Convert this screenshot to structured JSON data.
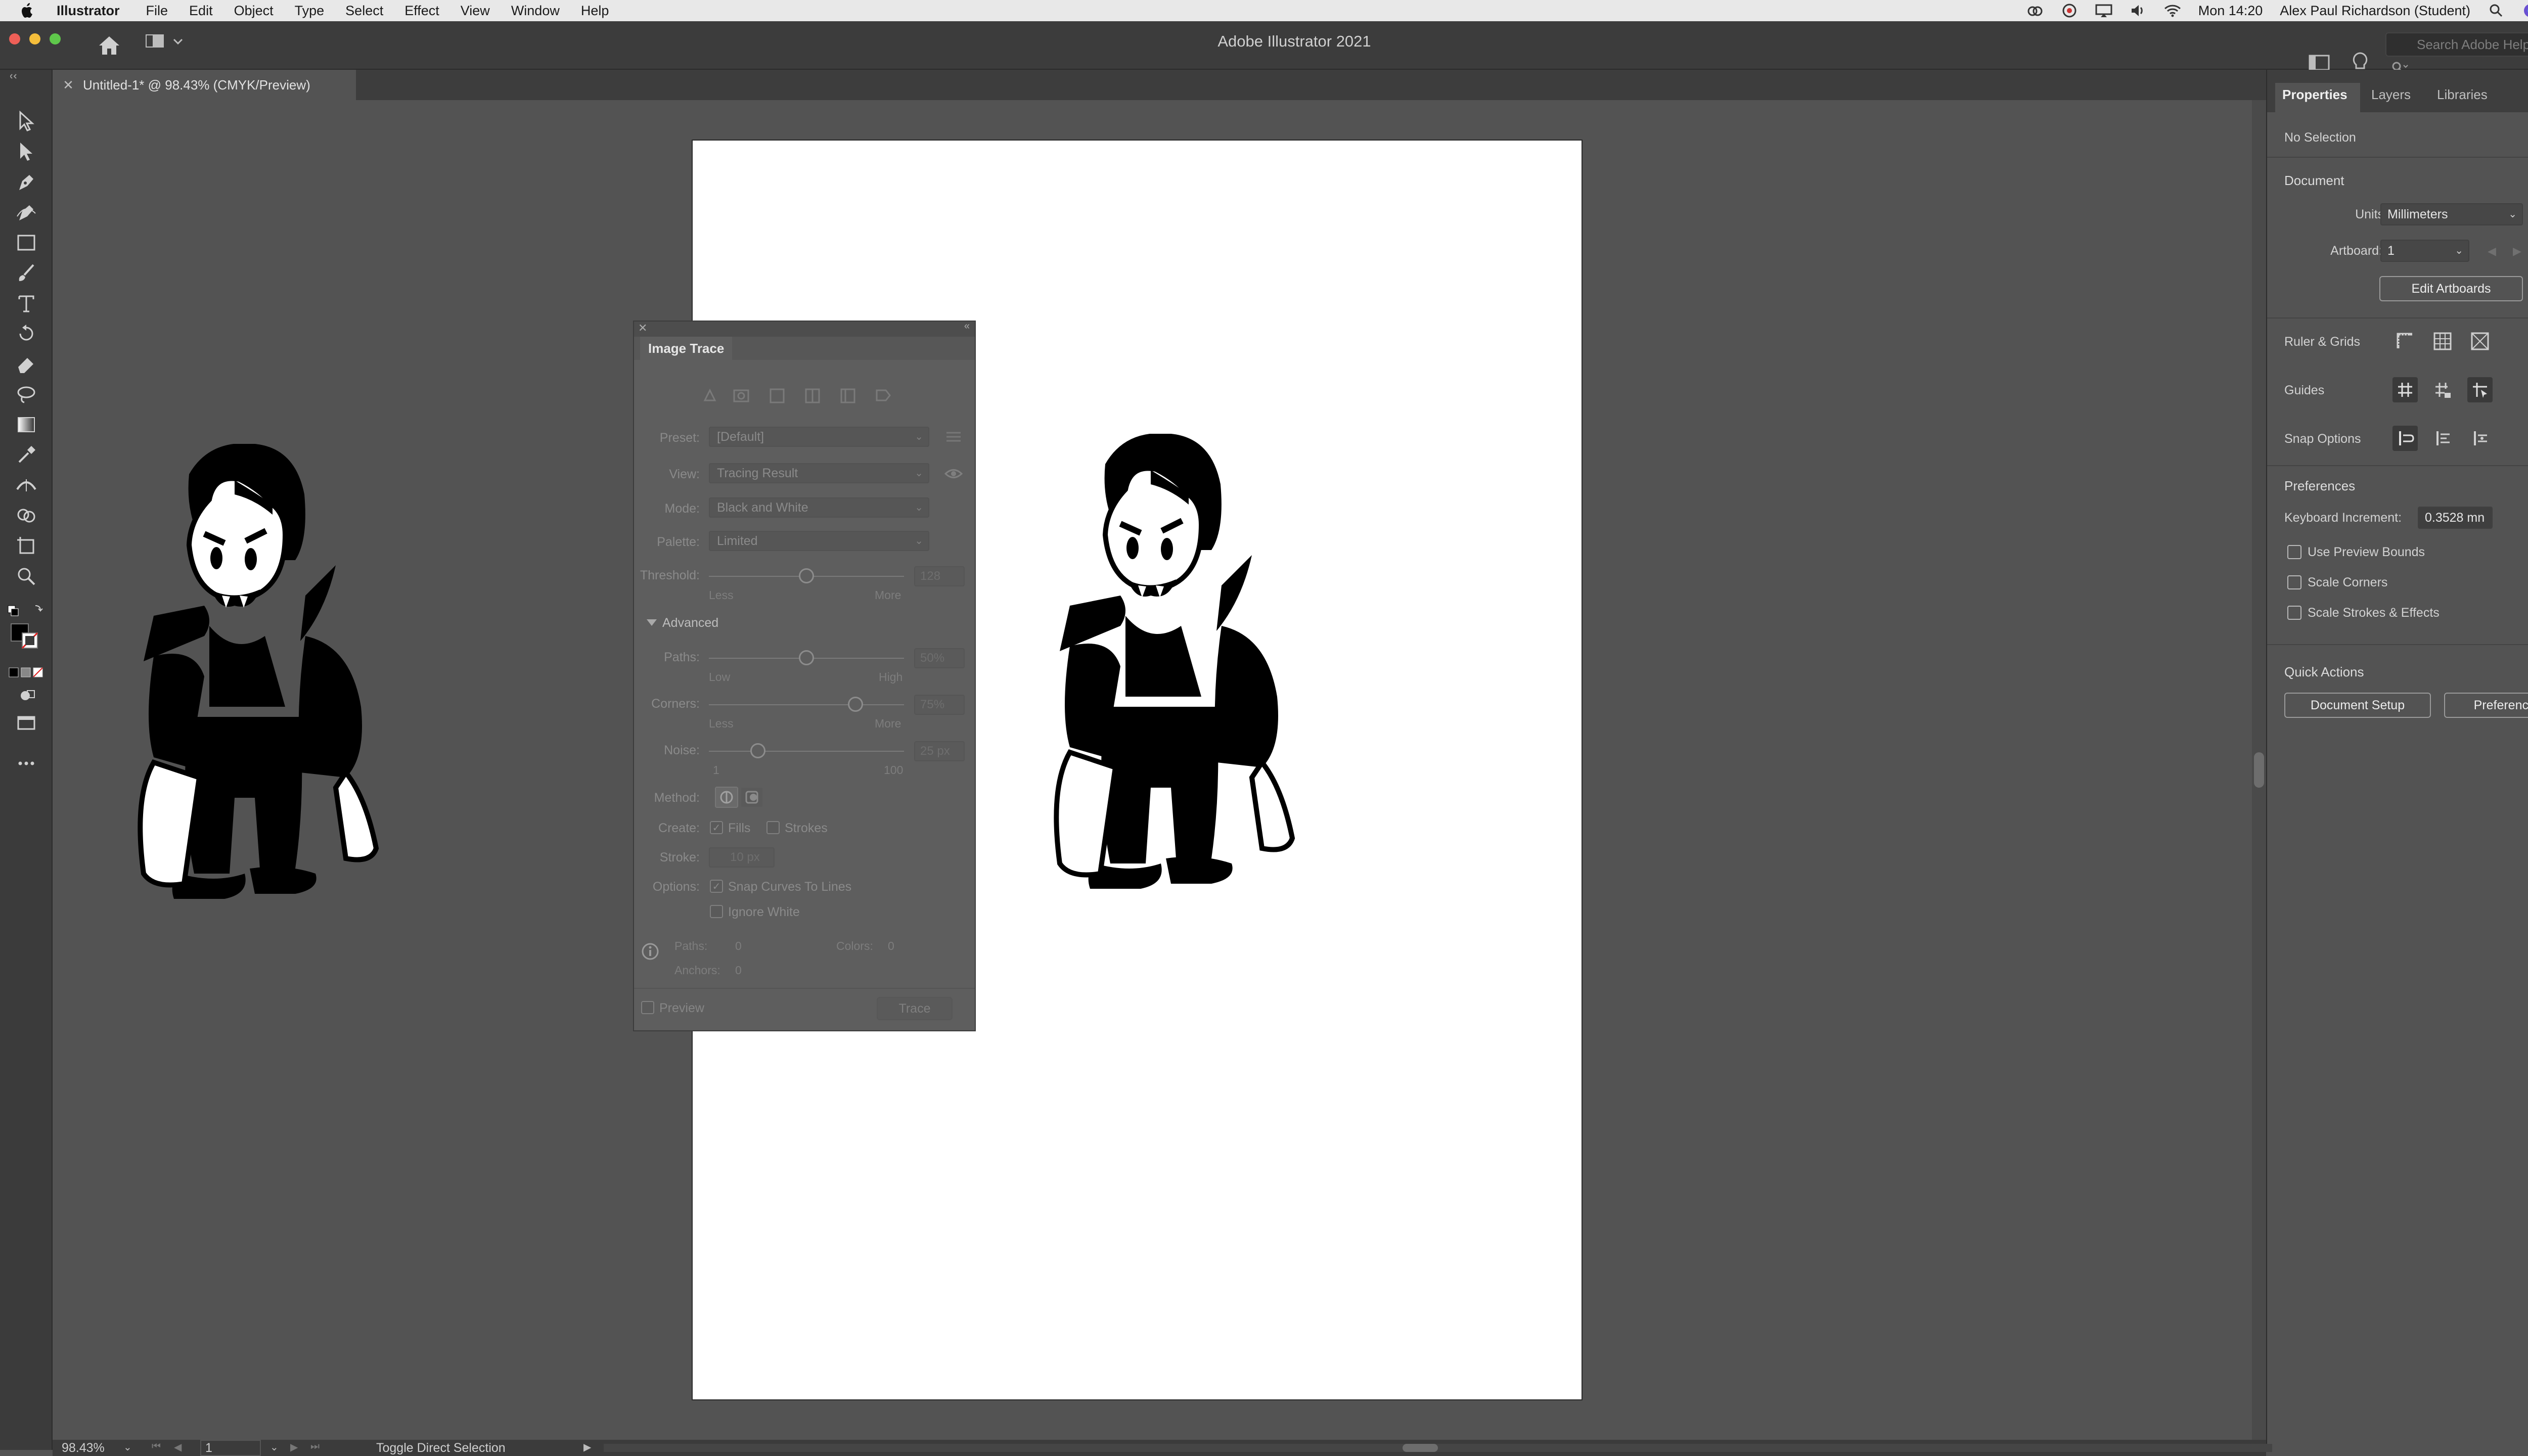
{
  "menubar": {
    "app_name": "Illustrator",
    "items": [
      "File",
      "Edit",
      "Object",
      "Type",
      "Select",
      "Effect",
      "View",
      "Window",
      "Help"
    ],
    "clock": "Mon 14:20",
    "user": "Alex Paul Richardson (Student)"
  },
  "appbar": {
    "title": "Adobe Illustrator 2021",
    "search_placeholder": "Search Adobe Help"
  },
  "document": {
    "tab_label": "Untitled-1* @ 98.43% (CMYK/Preview)"
  },
  "image_trace": {
    "title": "Image Trace",
    "preset_label": "Preset:",
    "preset_value": "[Default]",
    "view_label": "View:",
    "view_value": "Tracing Result",
    "mode_label": "Mode:",
    "mode_value": "Black and White",
    "palette_label": "Palette:",
    "palette_value": "Limited",
    "threshold_label": "Threshold:",
    "threshold_value": "128",
    "threshold_level": 0.5,
    "threshold_min_label": "Less",
    "threshold_max_label": "More",
    "advanced_label": "Advanced",
    "paths_label": "Paths:",
    "paths_value": "50%",
    "paths_level": 0.5,
    "paths_min_label": "Low",
    "paths_max_label": "High",
    "corners_label": "Corners:",
    "corners_value": "75%",
    "corners_level": 0.75,
    "corners_min_label": "Less",
    "corners_max_label": "More",
    "noise_label": "Noise:",
    "noise_value": "25 px",
    "noise_level": 0.25,
    "noise_min_label": "1",
    "noise_max_label": "100",
    "method_label": "Method:",
    "create_label": "Create:",
    "fills_label": "Fills",
    "fills_checked": true,
    "strokes_label": "Strokes",
    "strokes_checked": false,
    "stroke_label": "Stroke:",
    "stroke_value": "10 px",
    "options_label": "Options:",
    "snap_label": "Snap Curves To Lines",
    "snap_checked": true,
    "ignore_white_label": "Ignore White",
    "ignore_white_checked": false,
    "info_paths_label": "Paths:",
    "info_paths_value": "0",
    "info_colors_label": "Colors:",
    "info_colors_value": "0",
    "info_anchors_label": "Anchors:",
    "info_anchors_value": "0",
    "preview_label": "Preview",
    "trace_button": "Trace"
  },
  "properties": {
    "tabs": [
      "Properties",
      "Layers",
      "Libraries"
    ],
    "no_selection": "No Selection",
    "document_heading": "Document",
    "units_label": "Units:",
    "units_value": "Millimeters",
    "artboard_label": "Artboard:",
    "artboard_value": "1",
    "edit_artboards_button": "Edit Artboards",
    "ruler_grids_label": "Ruler & Grids",
    "guides_label": "Guides",
    "snap_options_label": "Snap Options",
    "preferences_heading": "Preferences",
    "keyboard_increment_label": "Keyboard Increment:",
    "keyboard_increment_value": "0.3528 mn",
    "use_preview_bounds": "Use Preview Bounds",
    "scale_corners": "Scale Corners",
    "scale_strokes": "Scale Strokes & Effects",
    "quick_actions_heading": "Quick Actions",
    "document_setup_button": "Document Setup",
    "preferences_button": "Preferences"
  },
  "statusbar": {
    "zoom": "98.43%",
    "page": "1",
    "message": "Toggle Direct Selection"
  },
  "colors": {
    "ui_dark": "#3c3c3c",
    "canvas": "#535353",
    "artboard": "#ffffff",
    "ink": "#000000"
  }
}
